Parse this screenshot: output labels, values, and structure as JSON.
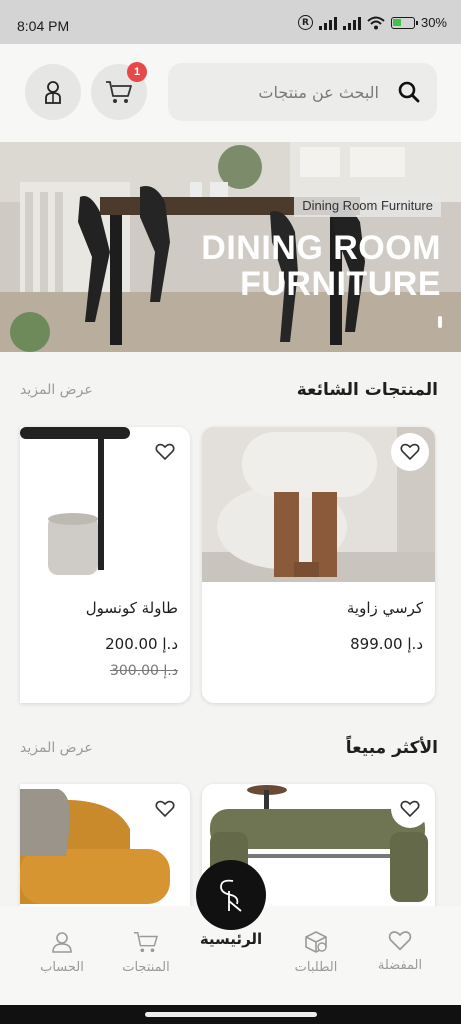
{
  "status_bar": {
    "time": "8:04 PM",
    "battery": "30%"
  },
  "search": {
    "placeholder": "البحث عن منتجات"
  },
  "cart": {
    "badge_count": "1"
  },
  "hero": {
    "tag": "Dining Room Furniture",
    "title_line1": "DINING ROOM",
    "title_line2": "FURNITURE"
  },
  "popular": {
    "title": "المنتجات الشائعة",
    "see_more": "عرض المزيد",
    "products": [
      {
        "name": "كرسي زاوية",
        "price": "د.إ 899.00",
        "old_price": ""
      },
      {
        "name": "طاولة كونسول",
        "price": "د.إ 200.00",
        "old_price": "د.إ 300.00"
      }
    ]
  },
  "best_sellers": {
    "title": "الأكثر مبيعاً",
    "see_more": "عرض المزيد"
  },
  "fab": {
    "logo_text": "SK"
  },
  "bottom_nav": {
    "items": [
      {
        "label": "الحساب"
      },
      {
        "label": "المنتجات"
      },
      {
        "label": "الرئيسية"
      },
      {
        "label": "الطلبات"
      },
      {
        "label": "المفضلة"
      }
    ]
  },
  "colors": {
    "badge": "#e74848",
    "fab": "#111111",
    "background": "#f4f4f3"
  },
  "icons": [
    "search-icon",
    "cart-icon",
    "user-icon",
    "heart-icon",
    "box-icon",
    "home-logo"
  ]
}
